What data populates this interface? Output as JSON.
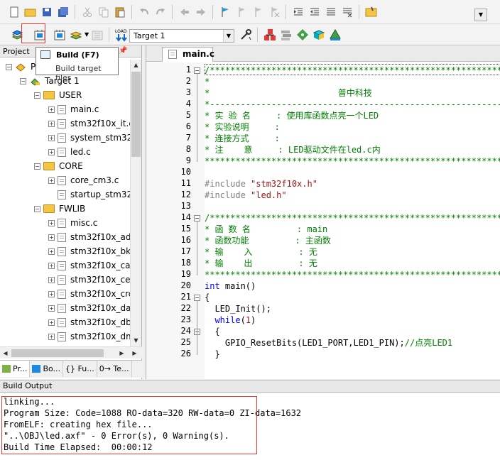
{
  "toolbar2": {
    "target": "Target 1"
  },
  "project": {
    "title": "Project",
    "root": "P",
    "target": "Target 1",
    "groups": [
      {
        "name": "USER",
        "files": [
          "main.c",
          "stm32f10x_it.c",
          "system_stm32",
          "led.c"
        ]
      },
      {
        "name": "CORE",
        "files": [
          "core_cm3.c",
          "startup_stm32"
        ]
      },
      {
        "name": "FWLIB",
        "files": [
          "misc.c",
          "stm32f10x_adc",
          "stm32f10x_bkp",
          "stm32f10x_can",
          "stm32f10x_cec",
          "stm32f10x_crc",
          "stm32f10x_dac",
          "stm32f10x_dbg",
          "stm32f10x_dm"
        ]
      }
    ],
    "tabs": [
      "Pr...",
      "Bo...",
      "{} Fu...",
      "0→ Te..."
    ]
  },
  "tooltip": {
    "title": "Build (F7)",
    "desc": "Build target files"
  },
  "editor": {
    "tab": "main.c",
    "line_numbers": [
      "1",
      "2",
      "3",
      "4",
      "5",
      "6",
      "7",
      "8",
      "9",
      "10",
      "11",
      "12",
      "13",
      "14",
      "15",
      "16",
      "17",
      "18",
      "19",
      "20",
      "21",
      "22",
      "23",
      "24",
      "25",
      "26"
    ],
    "lines": [
      "/**********************************************************",
      "*",
      "*                         普中科技",
      "*---------------------------------------------------------",
      "* 实 验 名     : 使用库函数点亮一个LED",
      "* 实验说明     :",
      "* 连接方式     :",
      "* 注    意     : LED驱动文件在led.c内",
      "**********************************************************",
      "",
      "#include \"stm32f10x.h\"",
      "#include \"led.h\"",
      "",
      "/**********************************************************",
      "* 函 数 名         : main",
      "* 函数功能         : 主函数",
      "* 输    入         : 无",
      "* 输    出         : 无",
      "**********************************************************",
      "int main()",
      "{",
      "  LED_Init();",
      "  while(1)",
      "  {",
      "    GPIO_ResetBits(LED1_PORT,LED1_PIN);//点亮LED1",
      "  }"
    ]
  },
  "output": {
    "title": "Build Output",
    "lines": [
      "linking...",
      "Program Size: Code=1088 RO-data=320 RW-data=0 ZI-data=1632",
      "FromELF: creating hex file...",
      "\"..\\OBJ\\led.axf\" - 0 Error(s), 0 Warning(s).",
      "Build Time Elapsed:  00:00:12"
    ]
  },
  "colors": {
    "comment": "#008000",
    "keyword": "#0000ff",
    "preprocessor": "#808080",
    "string": "#a31515",
    "highlight": "#e53935"
  }
}
